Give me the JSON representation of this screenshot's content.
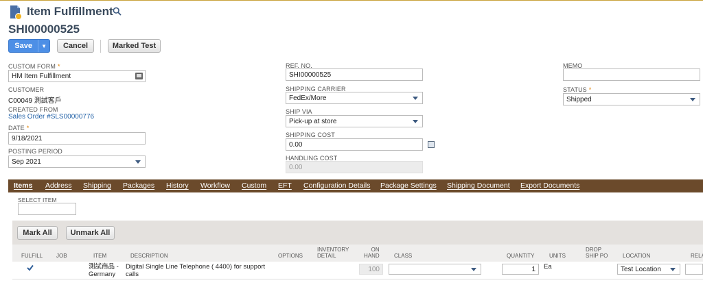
{
  "header": {
    "title": "Item Fulfillment",
    "record_id": "SHI00000525"
  },
  "buttons": {
    "save": "Save",
    "cancel": "Cancel",
    "marked_test": "Marked Test"
  },
  "fields": {
    "custom_form": {
      "label": "CUSTOM FORM",
      "value": "HM Item Fulfillment"
    },
    "customer": {
      "label": "CUSTOMER",
      "value": "C00049 測試客戶"
    },
    "created_from": {
      "label": "CREATED FROM",
      "value": "Sales Order #SLS00000776"
    },
    "date": {
      "label": "DATE",
      "value": "9/18/2021"
    },
    "posting_period": {
      "label": "POSTING PERIOD",
      "value": "Sep 2021"
    },
    "ref_no": {
      "label": "REF. NO.",
      "value": "SHI00000525"
    },
    "shipping_carrier": {
      "label": "SHIPPING CARRIER",
      "value": "FedEx/More"
    },
    "ship_via": {
      "label": "SHIP VIA",
      "value": "Pick-up at store"
    },
    "shipping_cost": {
      "label": "SHIPPING COST",
      "value": "0.00"
    },
    "handling_cost": {
      "label": "HANDLING COST",
      "value": "0.00"
    },
    "memo": {
      "label": "MEMO",
      "value": ""
    },
    "status": {
      "label": "STATUS",
      "value": "Shipped"
    }
  },
  "tabs": [
    "Items",
    "Address",
    "Shipping",
    "Packages",
    "History",
    "Workflow",
    "Custom",
    "EFT",
    "Configuration Details",
    "Package Settings",
    "Shipping Document",
    "Export Documents"
  ],
  "items_tab": {
    "select_item_label": "SELECT ITEM",
    "mark_all": "Mark All",
    "unmark_all": "Unmark All",
    "columns": [
      "FULFILL",
      "JOB",
      "ITEM",
      "DESCRIPTION",
      "OPTIONS",
      "INVENTORY\nDETAIL",
      "ON\nHAND",
      "CLASS",
      "QUANTITY",
      "UNITS",
      "DROP\nSHIP PO",
      "LOCATION",
      "RELA"
    ],
    "row": {
      "fulfill": true,
      "item": "測試商品 -\nGermany",
      "description": "Digital Single Line Telephone ( 4400) for support\ncalls",
      "on_hand": "100",
      "class": "",
      "quantity": "1",
      "units": "Ea",
      "location": "Test Location"
    }
  },
  "colors": {
    "tab_bar": "#6b4a2b",
    "save_button": "#4d8fe6",
    "title": "#3a4a5c"
  }
}
